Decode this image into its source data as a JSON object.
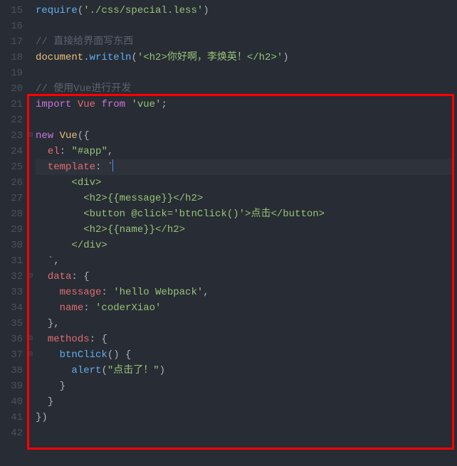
{
  "first_line_number": 15,
  "lines": [
    {
      "n": 15,
      "fold": "",
      "tokens": [
        {
          "c": "fn",
          "t": "require"
        },
        {
          "c": "pn",
          "t": "("
        },
        {
          "c": "str",
          "t": "'./css/special.less'"
        },
        {
          "c": "pn",
          "t": ")"
        }
      ]
    },
    {
      "n": 16,
      "fold": "",
      "tokens": []
    },
    {
      "n": 17,
      "fold": "",
      "tokens": [
        {
          "c": "cmt",
          "t": "// 直接给界面写东西"
        }
      ]
    },
    {
      "n": 18,
      "fold": "",
      "tokens": [
        {
          "c": "id",
          "t": "document"
        },
        {
          "c": "pn",
          "t": "."
        },
        {
          "c": "fn",
          "t": "writeln"
        },
        {
          "c": "pn",
          "t": "("
        },
        {
          "c": "str",
          "t": "'<h2>你好啊，李焕英！</h2>'"
        },
        {
          "c": "pn",
          "t": ")"
        }
      ]
    },
    {
      "n": 19,
      "fold": "",
      "tokens": []
    },
    {
      "n": 20,
      "fold": "",
      "tokens": [
        {
          "c": "cmt",
          "t": "// 使用Vue进行开发"
        }
      ]
    },
    {
      "n": 21,
      "fold": "",
      "tokens": [
        {
          "c": "kw",
          "t": "import"
        },
        {
          "c": "pn",
          "t": " "
        },
        {
          "c": "pr",
          "t": "Vue"
        },
        {
          "c": "pn",
          "t": " "
        },
        {
          "c": "kw",
          "t": "from"
        },
        {
          "c": "pn",
          "t": " "
        },
        {
          "c": "str",
          "t": "'vue'"
        },
        {
          "c": "pn",
          "t": ";"
        }
      ]
    },
    {
      "n": 22,
      "fold": "",
      "tokens": []
    },
    {
      "n": 23,
      "fold": "⊟",
      "tokens": [
        {
          "c": "kw",
          "t": "new"
        },
        {
          "c": "pn",
          "t": " "
        },
        {
          "c": "id",
          "t": "Vue"
        },
        {
          "c": "pn",
          "t": "({"
        }
      ]
    },
    {
      "n": 24,
      "fold": "",
      "indent": 1,
      "tokens": [
        {
          "c": "pr",
          "t": "el"
        },
        {
          "c": "pn",
          "t": ": "
        },
        {
          "c": "str",
          "t": "\"#app\""
        },
        {
          "c": "pn",
          "t": ","
        }
      ]
    },
    {
      "n": 25,
      "fold": "",
      "indent": 1,
      "active": true,
      "cursor": true,
      "tokens": [
        {
          "c": "pr",
          "t": "template"
        },
        {
          "c": "pn",
          "t": ": "
        },
        {
          "c": "str",
          "t": "`"
        }
      ]
    },
    {
      "n": 26,
      "fold": "",
      "indent": 3,
      "tokens": [
        {
          "c": "str",
          "t": "<div>"
        }
      ]
    },
    {
      "n": 27,
      "fold": "",
      "indent": 4,
      "tokens": [
        {
          "c": "str",
          "t": "<h2>{{message}}</h2>"
        }
      ]
    },
    {
      "n": 28,
      "fold": "",
      "indent": 4,
      "tokens": [
        {
          "c": "str",
          "t": "<button @click='btnClick()'>点击</button>"
        }
      ]
    },
    {
      "n": 29,
      "fold": "",
      "indent": 4,
      "tokens": [
        {
          "c": "str",
          "t": "<h2>{{name}}</h2>"
        }
      ]
    },
    {
      "n": 30,
      "fold": "",
      "indent": 3,
      "tokens": [
        {
          "c": "str",
          "t": "</div>"
        }
      ]
    },
    {
      "n": 31,
      "fold": "",
      "indent": 1,
      "tokens": [
        {
          "c": "str",
          "t": "`"
        },
        {
          "c": "pn",
          "t": ","
        }
      ]
    },
    {
      "n": 32,
      "fold": "⊟",
      "indent": 1,
      "tokens": [
        {
          "c": "pr",
          "t": "data"
        },
        {
          "c": "pn",
          "t": ": {"
        }
      ]
    },
    {
      "n": 33,
      "fold": "",
      "indent": 2,
      "tokens": [
        {
          "c": "pr",
          "t": "message"
        },
        {
          "c": "pn",
          "t": ": "
        },
        {
          "c": "str",
          "t": "'hello Webpack'"
        },
        {
          "c": "pn",
          "t": ","
        }
      ]
    },
    {
      "n": 34,
      "fold": "",
      "indent": 2,
      "tokens": [
        {
          "c": "pr",
          "t": "name"
        },
        {
          "c": "pn",
          "t": ": "
        },
        {
          "c": "str",
          "t": "'coderXiao'"
        }
      ]
    },
    {
      "n": 35,
      "fold": "",
      "indent": 1,
      "tokens": [
        {
          "c": "pn",
          "t": "},"
        }
      ]
    },
    {
      "n": 36,
      "fold": "⊟",
      "indent": 1,
      "tokens": [
        {
          "c": "pr",
          "t": "methods"
        },
        {
          "c": "pn",
          "t": ": {"
        }
      ]
    },
    {
      "n": 37,
      "fold": "⊟",
      "indent": 2,
      "tokens": [
        {
          "c": "fn",
          "t": "btnClick"
        },
        {
          "c": "pn",
          "t": "() {"
        }
      ]
    },
    {
      "n": 38,
      "fold": "",
      "indent": 3,
      "tokens": [
        {
          "c": "fn",
          "t": "alert"
        },
        {
          "c": "pn",
          "t": "("
        },
        {
          "c": "str",
          "t": "\"点击了！\""
        },
        {
          "c": "pn",
          "t": ")"
        }
      ]
    },
    {
      "n": 39,
      "fold": "",
      "indent": 2,
      "tokens": [
        {
          "c": "pn",
          "t": "}"
        }
      ]
    },
    {
      "n": 40,
      "fold": "",
      "indent": 1,
      "tokens": [
        {
          "c": "pn",
          "t": "}"
        }
      ]
    },
    {
      "n": 41,
      "fold": "",
      "tokens": [
        {
          "c": "pn",
          "t": "})"
        }
      ]
    },
    {
      "n": 42,
      "fold": "",
      "tokens": []
    }
  ],
  "highlight_box": {
    "present": true
  }
}
